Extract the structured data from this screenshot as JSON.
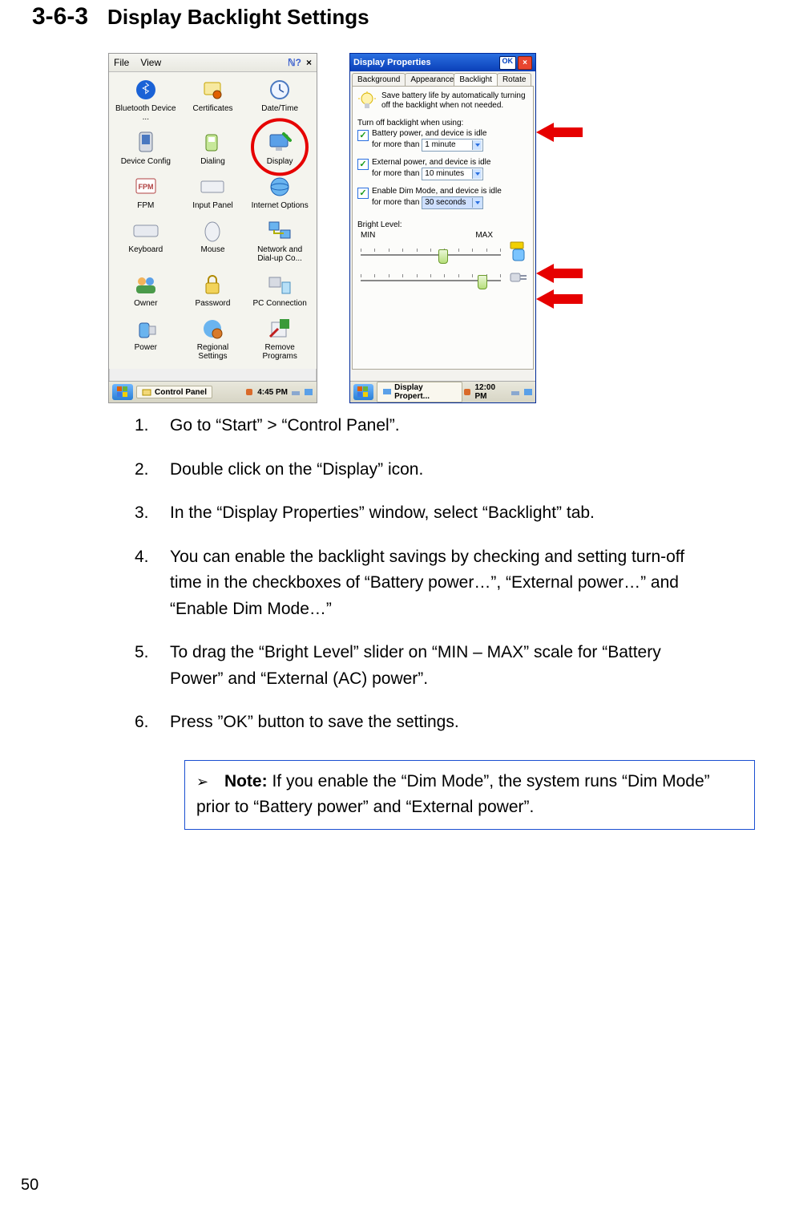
{
  "heading": {
    "num": "3-6-3",
    "title": "Display Backlight Settings"
  },
  "control_panel": {
    "menubar": {
      "file": "File",
      "view": "View"
    },
    "icons": [
      {
        "label": "Bluetooth Device ..."
      },
      {
        "label": "Certificates"
      },
      {
        "label": "Date/Time"
      },
      {
        "label": "Device Config"
      },
      {
        "label": "Dialing"
      },
      {
        "label": "Display"
      },
      {
        "label": "FPM"
      },
      {
        "label": "Input Panel"
      },
      {
        "label": "Internet Options"
      },
      {
        "label": "Keyboard"
      },
      {
        "label": "Mouse"
      },
      {
        "label": "Network and Dial-up Co..."
      },
      {
        "label": "Owner"
      },
      {
        "label": "Password"
      },
      {
        "label": "PC Connection"
      },
      {
        "label": "Power"
      },
      {
        "label": "Regional Settings"
      },
      {
        "label": "Remove Programs"
      }
    ],
    "taskbar": {
      "task_label": "Control Panel",
      "time": "4:45 PM"
    }
  },
  "display_properties": {
    "title": "Display Properties",
    "ok": "OK",
    "tabs": [
      "Background",
      "Appearance",
      "Backlight",
      "Rotate"
    ],
    "active_tab": 2,
    "tip": "Save battery life by automatically turning off the backlight when not needed.",
    "group_label": "Turn off backlight when using:",
    "opts": [
      {
        "label_a": "Battery power, and device is idle",
        "label_b": "for more than",
        "value": "1 minute"
      },
      {
        "label_a": "External power, and device is idle",
        "label_b": "for more than",
        "value": "10 minutes"
      },
      {
        "label_a": "Enable Dim Mode, and device is idle",
        "label_b": "for more than",
        "value": "30 seconds"
      }
    ],
    "bright_label": "Bright Level:",
    "min": "MIN",
    "max": "MAX",
    "slider1_pos": 0.55,
    "slider2_pos": 0.82,
    "taskbar": {
      "task_label": "Display Propert...",
      "time": "12:00 PM"
    }
  },
  "chart_data": {
    "type": "table",
    "title": "Bright Level sliders",
    "series": [
      {
        "name": "Battery power brightness",
        "values": [
          0.55
        ],
        "range": [
          0,
          1
        ]
      },
      {
        "name": "External power brightness",
        "values": [
          0.82
        ],
        "range": [
          0,
          1
        ]
      }
    ]
  },
  "steps": [
    {
      "n": "1.",
      "t": "Go to “Start” > “Control Panel”."
    },
    {
      "n": "2.",
      "t": "Double click on the “Display” icon."
    },
    {
      "n": "3.",
      "t": "In the “Display Properties” window, select “Backlight” tab."
    },
    {
      "n": "4.",
      "t": "You can enable the backlight savings by checking and setting turn-off time in the checkboxes of “Battery power…”, “External power…” and “Enable Dim Mode…”"
    },
    {
      "n": "5.",
      "t": "To drag the “Bright Level” slider on “MIN – MAX” scale for “Battery Power” and “External (AC) power”."
    },
    {
      "n": "6.",
      "t": "Press ”OK” button to save the settings."
    }
  ],
  "note": {
    "label": "Note:",
    "text": " If you enable the “Dim Mode”, the system runs “Dim Mode” prior to “Battery power” and “External power”."
  },
  "page_number": "50"
}
